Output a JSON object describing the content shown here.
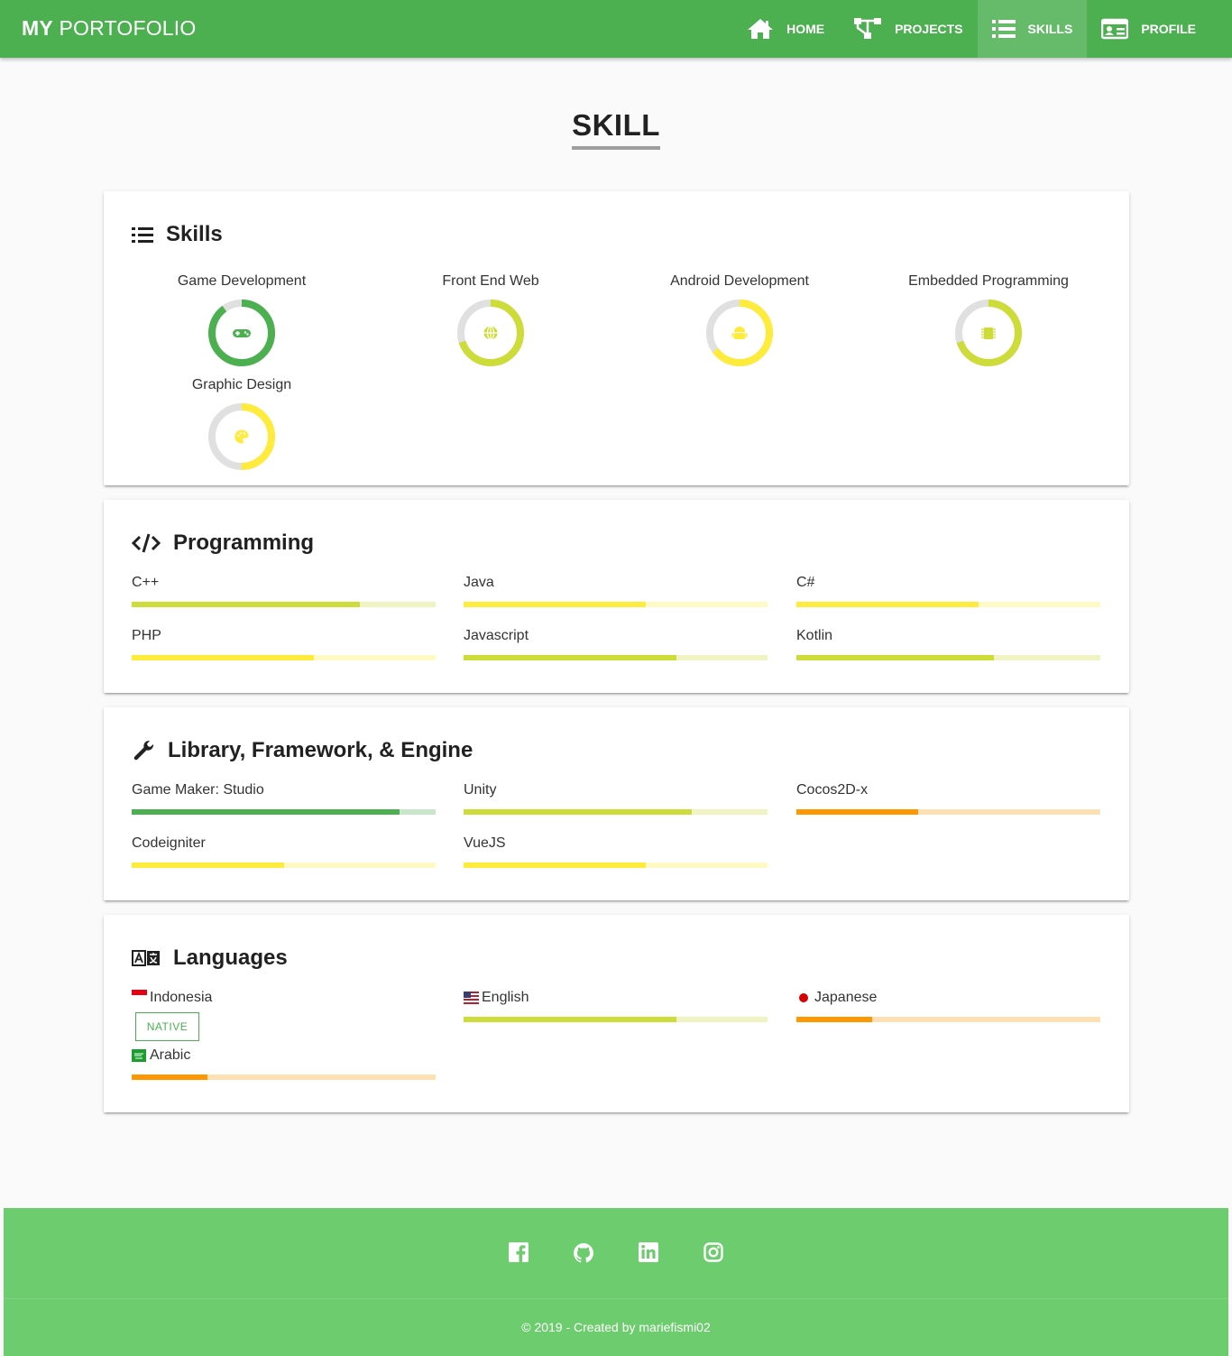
{
  "brand": {
    "bold": "MY",
    "rest": "PORTOFOLIO"
  },
  "nav": {
    "home": "HOME",
    "projects": "PROJECTS",
    "skills": "SKILLS",
    "profile": "PROFILE",
    "active": "skills"
  },
  "page_title": "SKILL",
  "skills_card": {
    "title": "Skills",
    "items": [
      {
        "label": "Game Development",
        "level": 0.9,
        "color": "#4caf50",
        "icon": "gamepad-icon"
      },
      {
        "label": "Front End Web",
        "level": 0.7,
        "color": "#cddc39",
        "icon": "globe-icon"
      },
      {
        "label": "Android Development",
        "level": 0.65,
        "color": "#ffeb3b",
        "icon": "android-icon"
      },
      {
        "label": "Embedded Programming",
        "level": 0.7,
        "color": "#cddc39",
        "icon": "chip-icon"
      },
      {
        "label": "Graphic Design",
        "level": 0.5,
        "color": "#ffeb3b",
        "icon": "palette-icon"
      }
    ]
  },
  "programming_card": {
    "title": "Programming",
    "items": [
      {
        "label": "C++",
        "level": 0.75,
        "color": "#cddc39",
        "track": "#f0f4c3"
      },
      {
        "label": "Java",
        "level": 0.6,
        "color": "#ffeb3b",
        "track": "#fff9c4"
      },
      {
        "label": "C#",
        "level": 0.6,
        "color": "#ffeb3b",
        "track": "#fff9c4"
      },
      {
        "label": "PHP",
        "level": 0.6,
        "color": "#ffeb3b",
        "track": "#fff9c4"
      },
      {
        "label": "Javascript",
        "level": 0.7,
        "color": "#cddc39",
        "track": "#f0f4c3"
      },
      {
        "label": "Kotlin",
        "level": 0.65,
        "color": "#cddc39",
        "track": "#f0f4c3"
      }
    ]
  },
  "library_card": {
    "title": "Library, Framework, & Engine",
    "items": [
      {
        "label": "Game Maker: Studio",
        "level": 0.88,
        "color": "#4caf50",
        "track": "#c8e6c9"
      },
      {
        "label": "Unity",
        "level": 0.75,
        "color": "#cddc39",
        "track": "#f0f4c3"
      },
      {
        "label": "Cocos2D-x",
        "level": 0.4,
        "color": "#ff9800",
        "track": "#ffe0b2"
      },
      {
        "label": "Codeigniter",
        "level": 0.5,
        "color": "#ffeb3b",
        "track": "#fff9c4"
      },
      {
        "label": "VueJS",
        "level": 0.6,
        "color": "#ffeb3b",
        "track": "#fff9c4"
      }
    ]
  },
  "languages_card": {
    "title": "Languages",
    "indonesia": {
      "label": "Indonesia",
      "badge": "NATIVE",
      "icon": "flag-indonesia-icon"
    },
    "arabic": {
      "label": "Arabic",
      "level": 0.25,
      "color": "#ff9800",
      "track": "#ffe0b2",
      "icon": "flag-saudi-icon"
    },
    "english": {
      "label": "English",
      "level": 0.7,
      "color": "#cddc39",
      "track": "#f0f4c3",
      "icon": "flag-usa-icon"
    },
    "japanese": {
      "label": "Japanese",
      "level": 0.25,
      "color": "#ff9800",
      "track": "#ffe0b2",
      "icon": "flag-japan-icon"
    }
  },
  "footer": {
    "social": [
      "facebook-icon",
      "github-icon",
      "linkedin-icon",
      "instagram-icon"
    ],
    "copyright": "© 2019 - Created by mariefismi02"
  },
  "colors": {
    "primary": "#4caf50",
    "footer": "#6ccc6e",
    "ring_track": "#e0e0e0"
  }
}
